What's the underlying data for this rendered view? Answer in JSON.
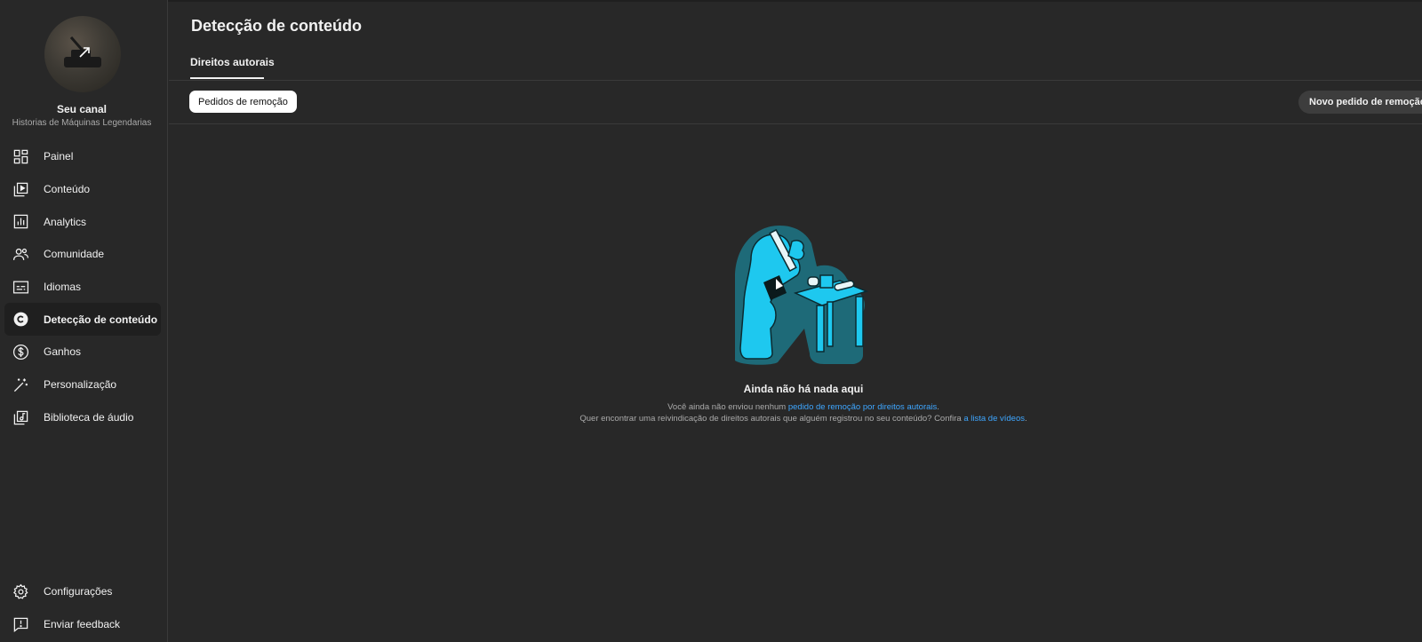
{
  "sidebar": {
    "channel_title": "Seu canal",
    "channel_name": "Historias de Máquinas Legendarias",
    "items": [
      {
        "label": "Painel",
        "icon": "dashboard-icon"
      },
      {
        "label": "Conteúdo",
        "icon": "content-icon"
      },
      {
        "label": "Analytics",
        "icon": "analytics-icon"
      },
      {
        "label": "Comunidade",
        "icon": "community-icon"
      },
      {
        "label": "Idiomas",
        "icon": "subtitles-icon"
      },
      {
        "label": "Detecção de conteúdo",
        "icon": "copyright-icon",
        "active": true
      },
      {
        "label": "Ganhos",
        "icon": "dollar-icon"
      },
      {
        "label": "Personalização",
        "icon": "magic-wand-icon"
      },
      {
        "label": "Biblioteca de áudio",
        "icon": "audio-library-icon"
      }
    ],
    "bottom_items": [
      {
        "label": "Configurações",
        "icon": "gear-icon"
      },
      {
        "label": "Enviar feedback",
        "icon": "feedback-icon"
      }
    ]
  },
  "main": {
    "title": "Detecção de conteúdo",
    "tab_label": "Direitos autorais",
    "chip_label": "Pedidos de remoção",
    "new_request_label": "Novo pedido de remoção",
    "empty": {
      "title": "Ainda não há nada aqui",
      "line1_prefix": "Você ainda não enviou nenhum ",
      "line1_link": "pedido de remoção por direitos autorais",
      "line1_suffix": ".",
      "line2_prefix": "Quer encontrar uma reivindicação de direitos autorais que alguém registrou no seu conteúdo? Confira ",
      "line2_link": "a lista de vídeos",
      "line2_suffix": "."
    }
  },
  "colors": {
    "background": "#282828",
    "link": "#3ea6ff",
    "illustration_cyan": "#1ec8ef",
    "illustration_teal": "#1e6a78"
  }
}
